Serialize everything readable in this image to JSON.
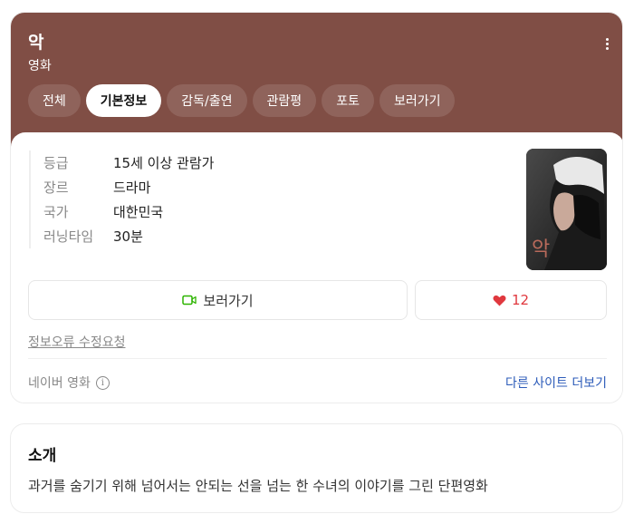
{
  "header": {
    "title": "악",
    "subtitle": "영화",
    "bg_color": "#804e45"
  },
  "tabs": [
    {
      "label": "전체",
      "active": false
    },
    {
      "label": "기본정보",
      "active": true
    },
    {
      "label": "감독/출연",
      "active": false
    },
    {
      "label": "관람평",
      "active": false
    },
    {
      "label": "포토",
      "active": false
    },
    {
      "label": "보러가기",
      "active": false
    }
  ],
  "info": [
    {
      "label": "등급",
      "value": "15세 이상 관람가"
    },
    {
      "label": "장르",
      "value": "드라마"
    },
    {
      "label": "국가",
      "value": "대한민국"
    },
    {
      "label": "러닝타임",
      "value": "30분"
    }
  ],
  "poster": {
    "title_text": "악"
  },
  "actions": {
    "watch_label": "보러가기",
    "watch_icon": "video-camera-icon",
    "like_icon": "heart-icon",
    "like_count": "12"
  },
  "report_label": "정보오류 수정요청",
  "source": {
    "label": "네이버 영화",
    "info_icon": "i"
  },
  "other_sites_label": "다른 사이트 더보기",
  "intro": {
    "title": "소개",
    "text": "과거를 숨기기 위해 넘어서는 안되는 선을 넘는 한 수녀의 이야기를 그린 단편영화"
  },
  "colors": {
    "accent_link": "#2c5bb9",
    "like": "#e0383e",
    "watch_icon": "#2db400"
  }
}
